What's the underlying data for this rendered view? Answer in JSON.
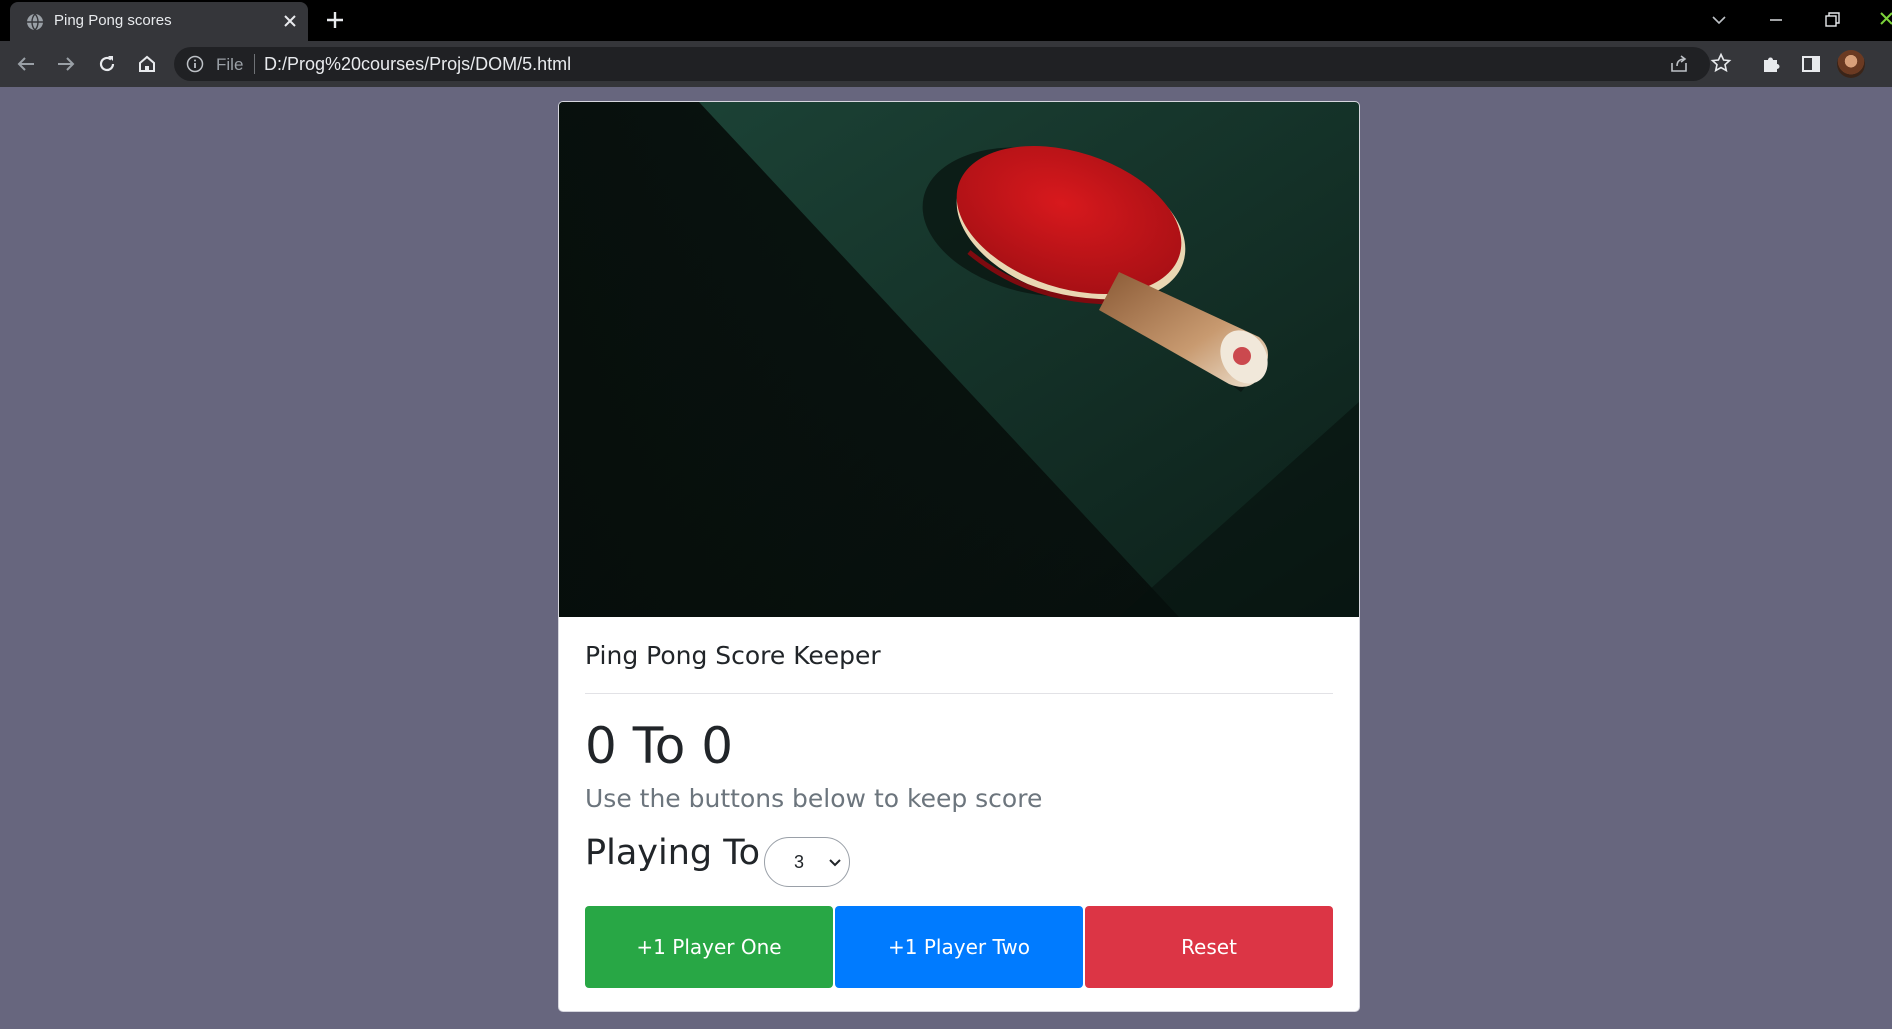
{
  "browser": {
    "tab_title": "Ping Pong scores",
    "url_scheme": "File",
    "url": "D:/Prog%20courses/Projs/DOM/5.html"
  },
  "page": {
    "card_title": "Ping Pong Score Keeper",
    "score": {
      "player_one": 0,
      "player_two": 0,
      "text": "0 To 0"
    },
    "instructions": "Use the buttons below to keep score",
    "playing_to_label": "Playing To",
    "playing_to_value": "3",
    "buttons": {
      "player_one": "+1 Player One",
      "player_two": "+1 Player Two",
      "reset": "Reset"
    }
  },
  "colors": {
    "page_background": "#67667e",
    "player_one": "#28a745",
    "player_two": "#007bff",
    "reset": "#dc3545",
    "paddle_red": "#c8161b",
    "table_green": "#1f4a3c"
  },
  "icons": {
    "tab": [
      "globe-icon",
      "close-icon",
      "plus-icon"
    ],
    "window": [
      "chevron-down-icon",
      "minimize-icon",
      "restore-icon",
      "close-icon"
    ],
    "toolbar": [
      "back-arrow-icon",
      "forward-arrow-icon",
      "reload-icon",
      "home-icon",
      "info-icon",
      "share-icon",
      "star-icon",
      "puzzle-icon",
      "sidepanel-icon",
      "avatar"
    ]
  }
}
